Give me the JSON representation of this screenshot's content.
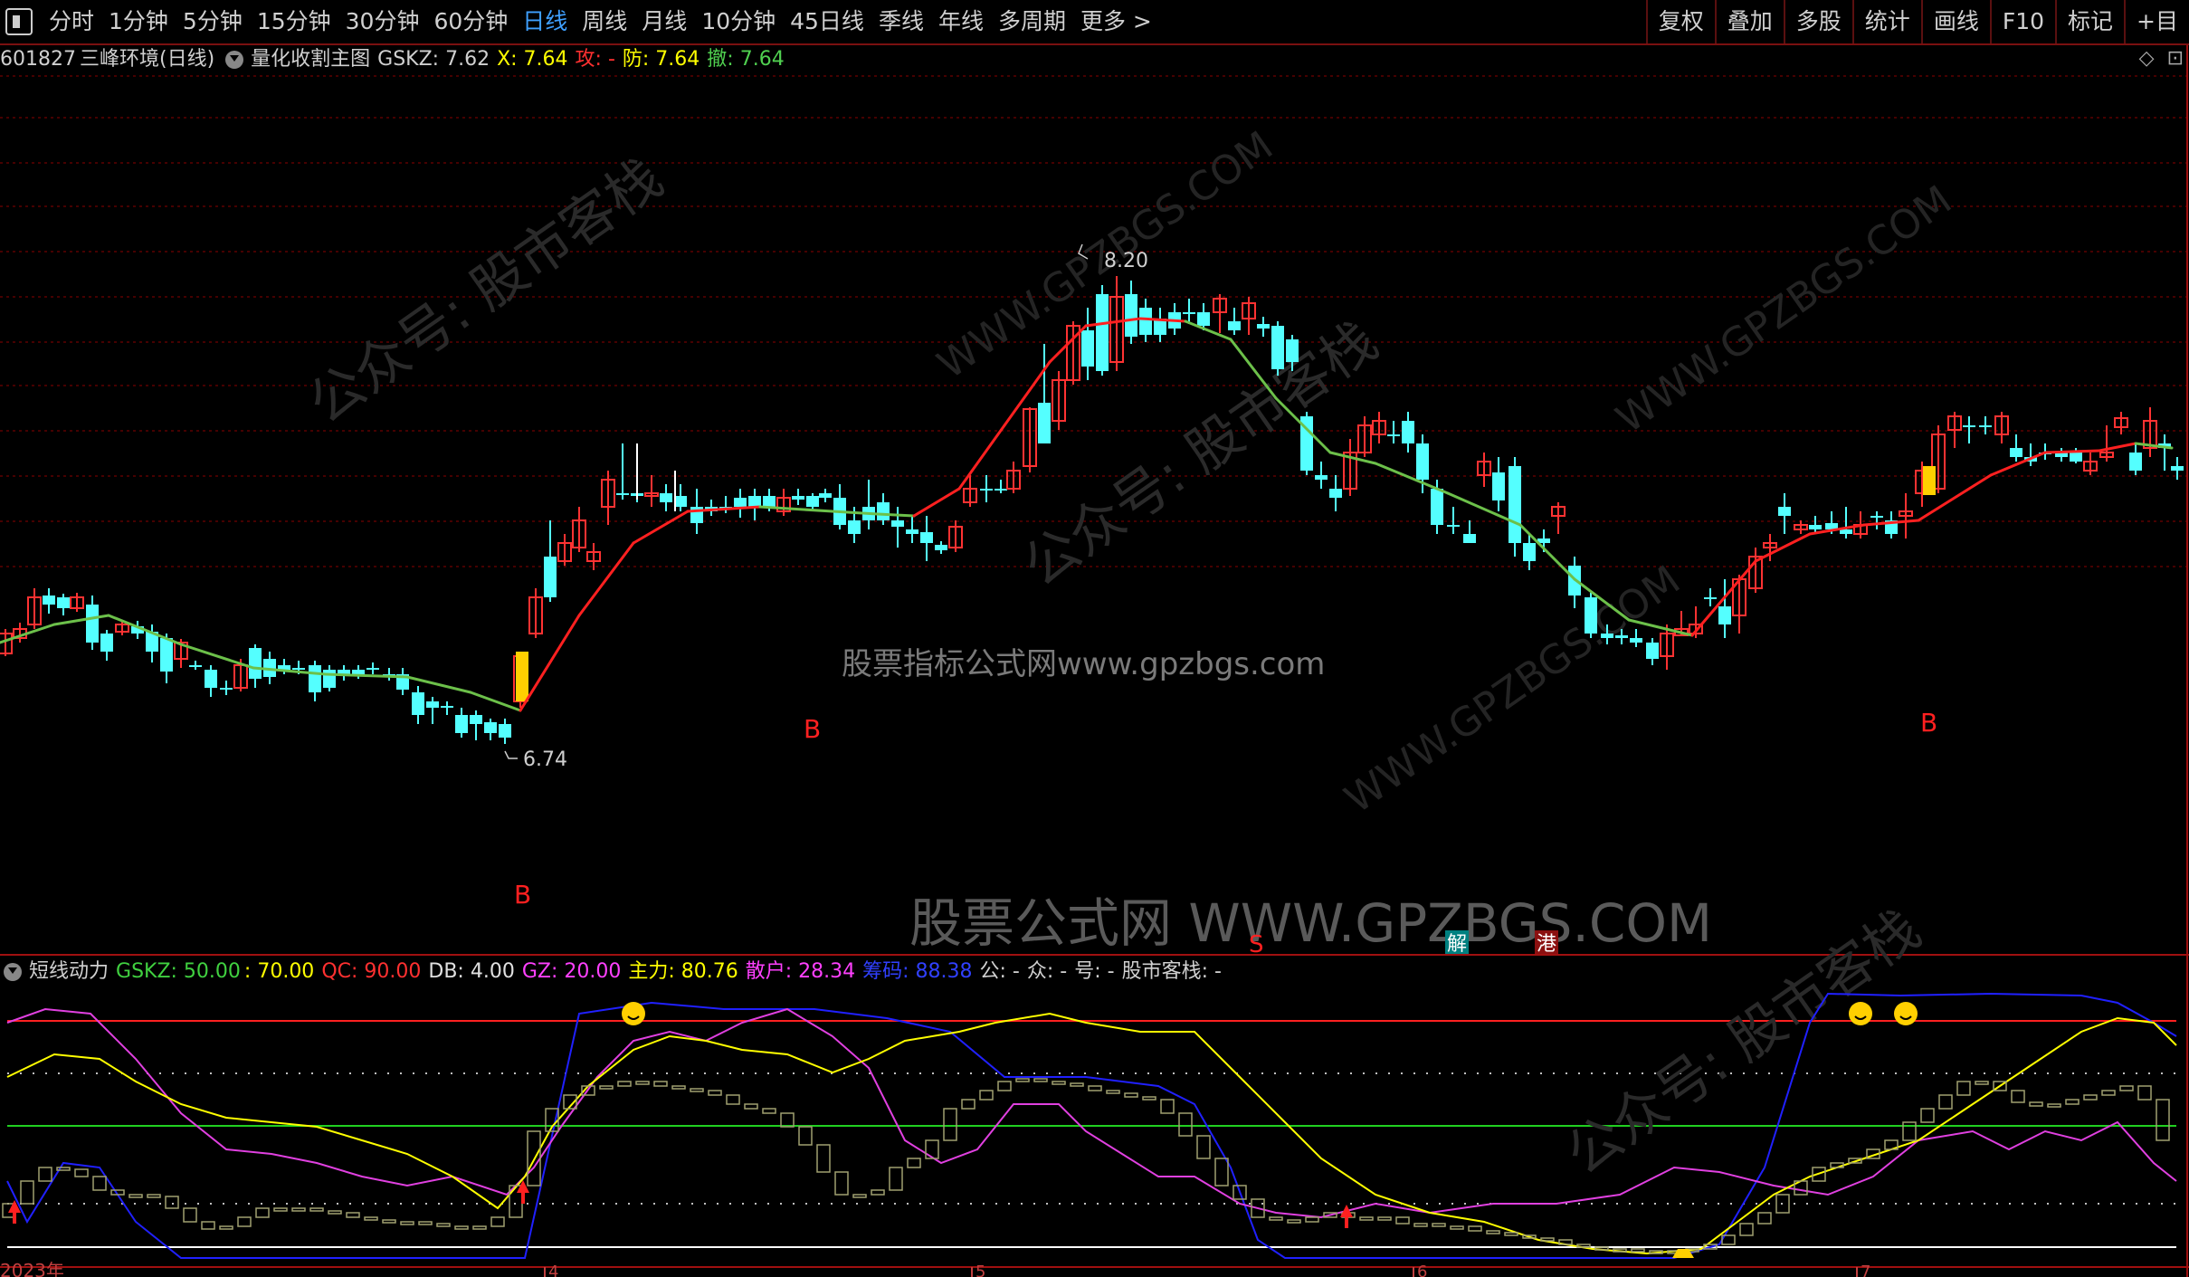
{
  "toolbar": {
    "tabs": [
      "分时",
      "1分钟",
      "5分钟",
      "15分钟",
      "30分钟",
      "60分钟",
      "日线",
      "周线",
      "月线",
      "10分钟",
      "45日线",
      "季线",
      "年线",
      "多周期",
      "更多 >"
    ],
    "active_tab": "日线",
    "right_tools": [
      "复权",
      "叠加",
      "多股",
      "统计",
      "画线",
      "F10",
      "标记",
      "+目"
    ]
  },
  "main_info": {
    "stock_code": "601827",
    "stock_name": "三峰环境(日线)",
    "indicator": "量化收割主图",
    "gskz": "GSKZ: 7.62",
    "x": "X: 7.64",
    "gong": "攻: -",
    "fang": "防: 7.64",
    "che": "撤: 7.64"
  },
  "sub_info": {
    "name": "短线动力",
    "gskz": "GSKZ: 50.00",
    "v70": ": 70.00",
    "qc": "QC: 90.00",
    "db": "DB: 4.00",
    "gz": "GZ: 20.00",
    "zhuli": "主力: 80.76",
    "sanhu": "散户: 28.34",
    "chouma": "筹码: 88.38",
    "gong": "公: -",
    "zhong": "众: -",
    "hao": "号: -",
    "brand": "股市客栈: -"
  },
  "annotations": {
    "high": "8.20",
    "low": "6.74",
    "buy": "B",
    "sell": "S",
    "jie": "解",
    "gang": "港",
    "year": "2023年",
    "months": [
      "4",
      "5",
      "6",
      "7"
    ]
  },
  "watermarks": {
    "small": "股票指标公式网www.gpzbgs.com",
    "large": "股票公式网 WWW.GPZBGS.COM",
    "diag1": "公众号: 股市客栈",
    "diag2": "WWW.GPZBGS.COM"
  },
  "colors": {
    "up": "#ff3232",
    "down": "#54ffff",
    "ma_up": "#ff2020",
    "ma_down": "#6cc04a",
    "grid": "#8b0000"
  }
}
